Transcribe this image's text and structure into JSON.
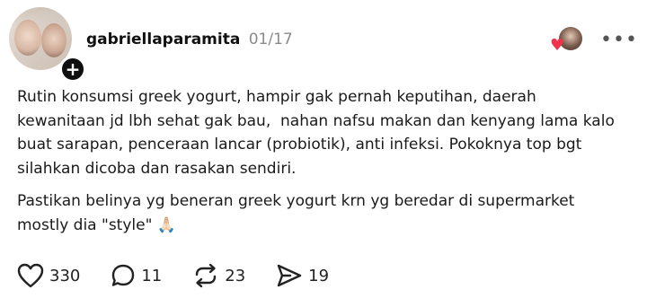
{
  "post": {
    "username": "gabriellaparamita",
    "date": "01/17",
    "follow_symbol": "+",
    "more_symbol": "•••",
    "paragraph1": "Rutin konsumsi greek yogurt, hampir gak pernah keputihan, daerah\nkewanitaan jd lbh sehat gak bau,  nahan nafsu makan dan kenyang lama kalo\nbuat sarapan, penceraan lancar (probiotik), anti infeksi. Pokoknya top bgt\nsilahkan dicoba dan rasakan sendiri.",
    "paragraph2_line1": "Pastikan belinya yg beneran greek yogurt krn yg beredar di supermarket",
    "paragraph2_line2": "mostly dia \"style\" 🙏🏻"
  },
  "actions": {
    "likes": "330",
    "replies": "11",
    "reposts": "23",
    "shares": "19"
  },
  "colors": {
    "heart": "#f0324a",
    "secondary_text": "#8a8a8a"
  },
  "icons": [
    "follow-plus-icon",
    "heart-icon",
    "more-icon",
    "like-icon",
    "reply-icon",
    "repost-icon",
    "share-icon"
  ]
}
